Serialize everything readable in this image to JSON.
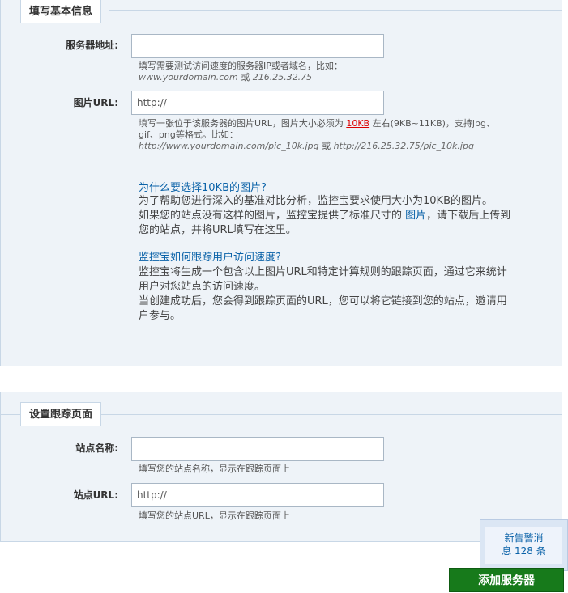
{
  "section1": {
    "title": "填写基本信息",
    "server_label": "服务器地址:",
    "server_value": "",
    "server_hint_1": "填写需要测试访问速度的服务器IP或者域名，比如：",
    "server_hint_ex1": "www.yourdomain.com",
    "server_hint_or": " 或 ",
    "server_hint_ex2": "216.25.32.75",
    "image_label": "图片URL:",
    "image_value": "http://",
    "image_hint_1a": "填写一张位于该服务器的图片URL，图片大小必须为 ",
    "image_hint_10kb": "10KB",
    "image_hint_1b": " 左右(9KB~11KB)，支持jpg、",
    "image_hint_2": "gif、png等格式。比如：",
    "image_hint_ex1": "http://www.yourdomain.com/pic_10k.jpg",
    "image_hint_or": " 或 ",
    "image_hint_ex2": "http://216.25.32.75/pic_10k.jpg",
    "faq1_q": "为什么要选择10KB的图片?",
    "faq1_a1": "为了帮助您进行深入的基准对比分析，监控宝要求使用大小为10KB的图片。",
    "faq1_a2a": "如果您的站点没有这样的图片，监控宝提供了标准尺寸的 ",
    "faq1_a2_link": "图片",
    "faq1_a2b": "，请下载后上传到",
    "faq1_a3": "您的站点，并将URL填写在这里。",
    "faq2_q": "监控宝如何跟踪用户访问速度?",
    "faq2_a1": "监控宝将生成一个包含以上图片URL和特定计算规则的跟踪页面，通过它来统计",
    "faq2_a2": "用户对您站点的访问速度。",
    "faq2_a3": "当创建成功后，您会得到跟踪页面的URL，您可以将它链接到您的站点，邀请用",
    "faq2_a4": "户参与。"
  },
  "section2": {
    "title": "设置跟踪页面",
    "site_name_label": "站点名称:",
    "site_name_value": "",
    "site_name_hint": "填写您的站点名称，显示在跟踪页面上",
    "site_url_label": "站点URL:",
    "site_url_value": "http://",
    "site_url_hint": "填写您的站点URL，显示在跟踪页面上"
  },
  "alert": {
    "line1": "新告警消",
    "line2": "息 128 条"
  },
  "submit_label": "添加服务器"
}
